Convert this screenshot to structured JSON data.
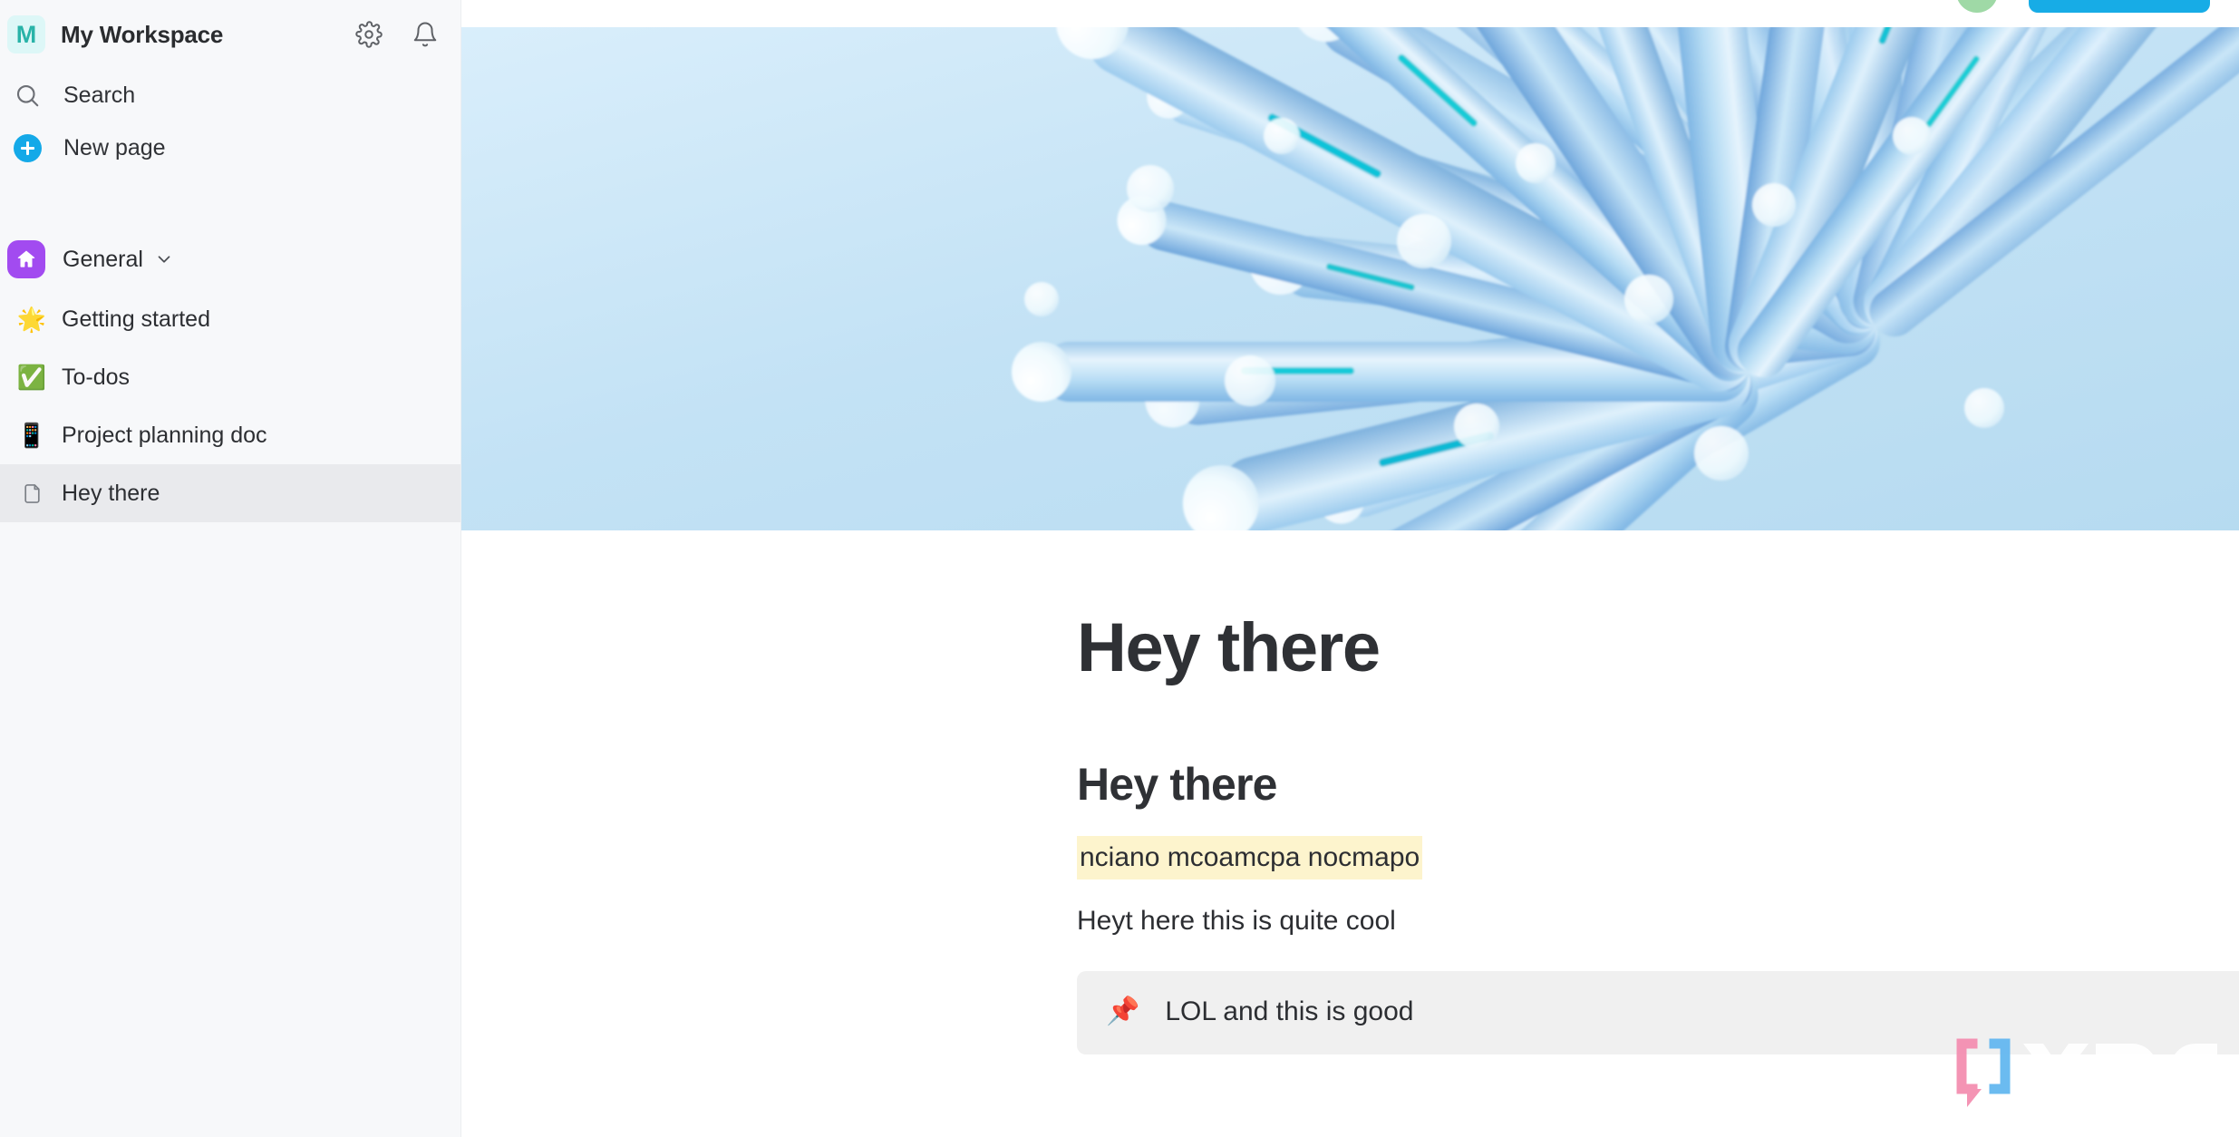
{
  "sidebar": {
    "workspace": {
      "badge_letter": "M",
      "name": "My Workspace",
      "settings_icon": "gear-icon",
      "notifications_icon": "bell-icon"
    },
    "nav": [
      {
        "icon": "search-icon",
        "label": "Search"
      },
      {
        "icon": "plus-circle-icon",
        "label": "New page"
      }
    ],
    "section": {
      "icon": "home-icon",
      "label": "General",
      "chevron": "chevron-down-icon",
      "expanded": true
    },
    "pages": [
      {
        "emoji": "🌟",
        "label": "Getting started",
        "active": false
      },
      {
        "emoji": "✅",
        "label": "To-dos",
        "active": false
      },
      {
        "emoji": "📱",
        "label": "Project planning doc",
        "active": false
      },
      {
        "emoji": "",
        "icon": "page-outline-icon",
        "label": "Hey there",
        "active": true
      }
    ]
  },
  "topbar": {
    "avatar": "user-avatar",
    "share_label": ""
  },
  "cover": {
    "alt": "abstract blue tubes render",
    "background_color": "#bfe0f2",
    "accent_color": "#16c4d4"
  },
  "document": {
    "title": "Hey there",
    "blocks": [
      {
        "type": "heading2",
        "text": "Hey there"
      },
      {
        "type": "paragraph_highlight",
        "text": "nciano mcoamcpa nocmapo",
        "highlight_color": "#fdf4cd"
      },
      {
        "type": "paragraph",
        "text": "Heyt here this is quite cool"
      },
      {
        "type": "callout",
        "emoji": "📌",
        "text": "LOL and this is good",
        "background_color": "#f0f0f0"
      }
    ]
  },
  "watermark": {
    "text": "XDA",
    "mark_left_color": "#f48fb1",
    "mark_right_color": "#64b8f0"
  }
}
